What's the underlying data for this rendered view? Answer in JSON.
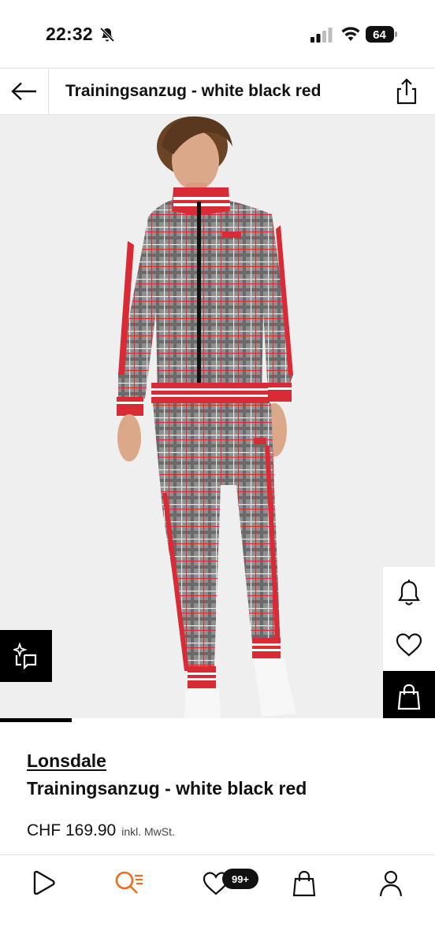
{
  "status_bar": {
    "time": "22:32",
    "battery": "64"
  },
  "header": {
    "title": "Trainingsanzug - white black red"
  },
  "product": {
    "brand": "Lonsdale",
    "name": "Trainingsanzug - white black red",
    "price": "CHF 169.90",
    "tax_note": "inkl. MwSt.",
    "image_carousel_progress": 0.165
  },
  "colors": {
    "accent": "#f26b1d",
    "suit_red": "#d92b35",
    "dark": "#111111",
    "background": "#efefef"
  },
  "bottom_nav": {
    "items": [
      "home-icon",
      "search-icon",
      "heart-icon",
      "bag-icon",
      "profile-icon"
    ],
    "wishlist_badge": "99+"
  },
  "icons": {
    "back": "arrow-left-icon",
    "share": "share-icon",
    "compare": "sparkle-compare-icon",
    "alert": "bell-icon",
    "wishlist": "heart-icon",
    "cart": "bag-icon"
  }
}
